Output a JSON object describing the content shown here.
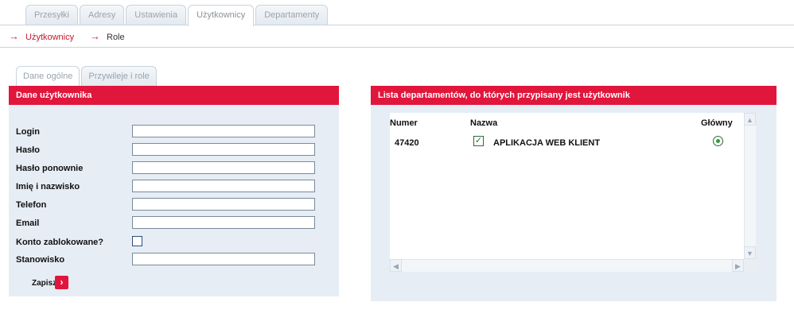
{
  "top_tabs": [
    {
      "label": "Przesyłki",
      "active": false
    },
    {
      "label": "Adresy",
      "active": false
    },
    {
      "label": "Ustawienia",
      "active": false
    },
    {
      "label": "Użytkownicy",
      "active": true
    },
    {
      "label": "Departamenty",
      "active": false
    }
  ],
  "breadcrumb": {
    "items": [
      {
        "label": "Użytkownicy",
        "icon": "arrow-right-icon"
      },
      {
        "label": "Role",
        "icon": "arrow-right-icon"
      }
    ]
  },
  "inner_tabs": [
    {
      "label": "Dane ogólne",
      "active": true
    },
    {
      "label": "Przywileje i role",
      "active": false
    }
  ],
  "user_panel": {
    "title": "Dane użytkownika",
    "fields": {
      "login": {
        "label": "Login",
        "value": ""
      },
      "password": {
        "label": "Hasło",
        "value": ""
      },
      "password_repeat": {
        "label": "Hasło ponownie",
        "value": ""
      },
      "full_name": {
        "label": "Imię i nazwisko",
        "value": ""
      },
      "phone": {
        "label": "Telefon",
        "value": ""
      },
      "email": {
        "label": "Email",
        "value": ""
      },
      "account_locked": {
        "label": "Konto zablokowane?",
        "checked": false
      },
      "position": {
        "label": "Stanowisko",
        "value": ""
      }
    },
    "save_label": "Zapisz",
    "save_icon": "chevron-right-icon"
  },
  "departments_panel": {
    "title": "Lista departamentów, do których przypisany jest użytkownik",
    "columns": [
      "Numer",
      "Nazwa",
      "Główny"
    ],
    "rows": [
      {
        "number": "47420",
        "checked": true,
        "name": "APLIKACJA WEB KLIENT",
        "primary": true
      }
    ]
  },
  "colors": {
    "accent": "#e1163c",
    "panel_bg": "#e6edf5",
    "link": "#c4172b"
  }
}
